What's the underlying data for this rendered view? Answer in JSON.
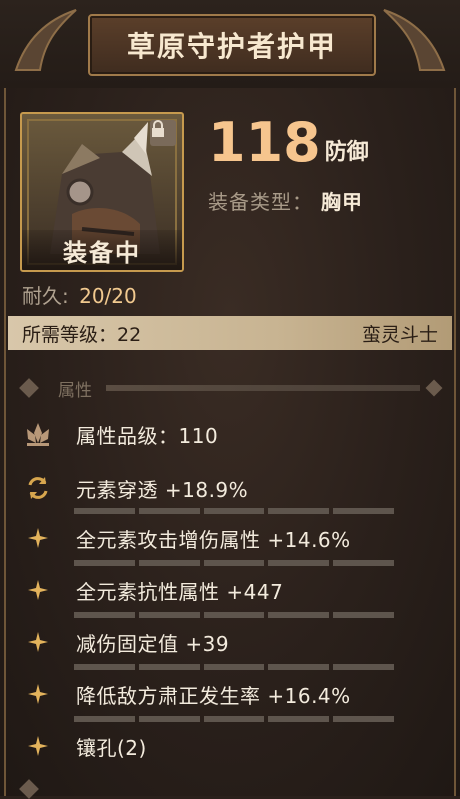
{
  "header": {
    "title": "草原守护者护甲"
  },
  "item": {
    "equipped_label": "装备中",
    "defense_value": "118",
    "defense_unit": "防御",
    "type_key": "装备类型：",
    "type_value": "胸甲",
    "durability_key": "耐久:",
    "durability_value": "20/20"
  },
  "requirement": {
    "level_text": "所需等级：22",
    "class_text": "蛮灵斗士"
  },
  "attributes_section": {
    "title": "属性"
  },
  "attributes": [
    {
      "icon": "lotus-crown-icon",
      "label": "属性品级：110"
    },
    {
      "icon": "refresh-cycle-icon",
      "label": "元素穿透 +18.9%"
    },
    {
      "icon": "sparkle-star-icon",
      "label": "全元素攻击增伤属性 +14.6%"
    },
    {
      "icon": "sparkle-star-icon",
      "label": "全元素抗性属性 +447"
    },
    {
      "icon": "sparkle-star-icon",
      "label": "减伤固定值 +39"
    },
    {
      "icon": "sparkle-star-icon",
      "label": "降低敌方肃正发生率 +16.4%"
    },
    {
      "icon": "sparkle-star-icon",
      "label": "镶孔(2)"
    }
  ],
  "colors": {
    "accent": "#f6c58e",
    "gold_border": "#c69a4e",
    "level_bar": "#d8c7aa"
  }
}
